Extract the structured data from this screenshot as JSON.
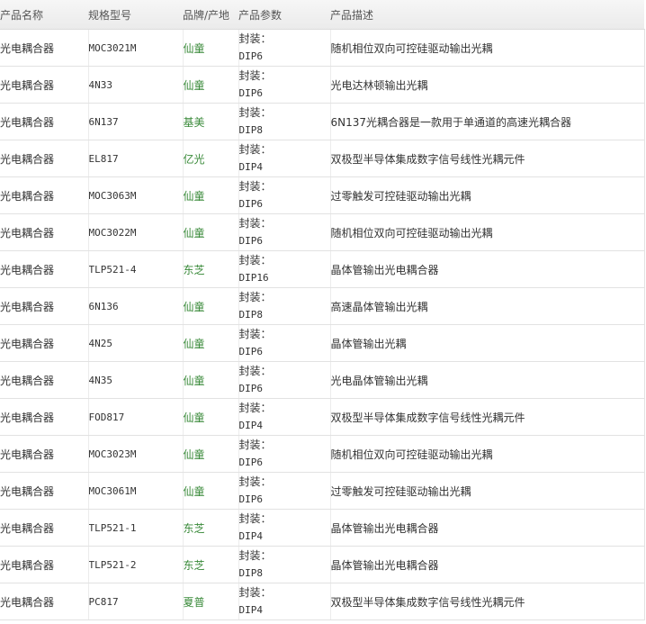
{
  "table": {
    "columns": [
      "产品名称",
      "规格型号",
      "品牌/产地",
      "产品参数",
      "产品描述"
    ],
    "rows": [
      {
        "name": "光电耦合器",
        "model": "MOC3021M",
        "brand": "仙童",
        "param_label": "封装：",
        "param_value": "DIP6",
        "description": "随机相位双向可控硅驱动输出光耦"
      },
      {
        "name": "光电耦合器",
        "model": "4N33",
        "brand": "仙童",
        "param_label": "封装：",
        "param_value": "DIP6",
        "description": "光电达林顿输出光耦"
      },
      {
        "name": "光电耦合器",
        "model": "6N137",
        "brand": "基美",
        "param_label": "封装：",
        "param_value": "DIP8",
        "description": "6N137光耦合器是一款用于单通道的高速光耦合器"
      },
      {
        "name": "光电耦合器",
        "model": "EL817",
        "brand": "亿光",
        "param_label": "封装：",
        "param_value": "DIP4",
        "description": "双极型半导体集成数字信号线性光耦元件"
      },
      {
        "name": "光电耦合器",
        "model": "MOC3063M",
        "brand": "仙童",
        "param_label": "封装：",
        "param_value": "DIP6",
        "description": "过零触发可控硅驱动输出光耦"
      },
      {
        "name": "光电耦合器",
        "model": "MOC3022M",
        "brand": "仙童",
        "param_label": "封装：",
        "param_value": "DIP6",
        "description": "随机相位双向可控硅驱动输出光耦"
      },
      {
        "name": "光电耦合器",
        "model": "TLP521-4",
        "brand": "东芝",
        "param_label": "封装：",
        "param_value": "DIP16",
        "description": "晶体管输出光电耦合器"
      },
      {
        "name": "光电耦合器",
        "model": "6N136",
        "brand": "仙童",
        "param_label": "封装：",
        "param_value": "DIP8",
        "description": "高速晶体管输出光耦"
      },
      {
        "name": "光电耦合器",
        "model": "4N25",
        "brand": "仙童",
        "param_label": "封装：",
        "param_value": "DIP6",
        "description": "晶体管输出光耦"
      },
      {
        "name": "光电耦合器",
        "model": "4N35",
        "brand": "仙童",
        "param_label": "封装：",
        "param_value": "DIP6",
        "description": "光电晶体管输出光耦"
      },
      {
        "name": "光电耦合器",
        "model": "FOD817",
        "brand": "仙童",
        "param_label": "封装：",
        "param_value": "DIP4",
        "description": "双极型半导体集成数字信号线性光耦元件"
      },
      {
        "name": "光电耦合器",
        "model": "MOC3023M",
        "brand": "仙童",
        "param_label": "封装：",
        "param_value": "DIP6",
        "description": "随机相位双向可控硅驱动输出光耦"
      },
      {
        "name": "光电耦合器",
        "model": "MOC3061M",
        "brand": "仙童",
        "param_label": "封装：",
        "param_value": "DIP6",
        "description": "过零触发可控硅驱动输出光耦"
      },
      {
        "name": "光电耦合器",
        "model": "TLP521-1",
        "brand": "东芝",
        "param_label": "封装：",
        "param_value": "DIP4",
        "description": "晶体管输出光电耦合器"
      },
      {
        "name": "光电耦合器",
        "model": "TLP521-2",
        "brand": "东芝",
        "param_label": "封装：",
        "param_value": "DIP8",
        "description": "晶体管输出光电耦合器"
      },
      {
        "name": "光电耦合器",
        "model": "PC817",
        "brand": "夏普",
        "param_label": "封装：",
        "param_value": "DIP4",
        "description": "双极型半导体集成数字信号线性光耦元件"
      }
    ]
  },
  "colors": {
    "brand_text": "#3a8a3a",
    "text": "#333333",
    "header_text": "#555555",
    "header_bg": "#efefef"
  }
}
